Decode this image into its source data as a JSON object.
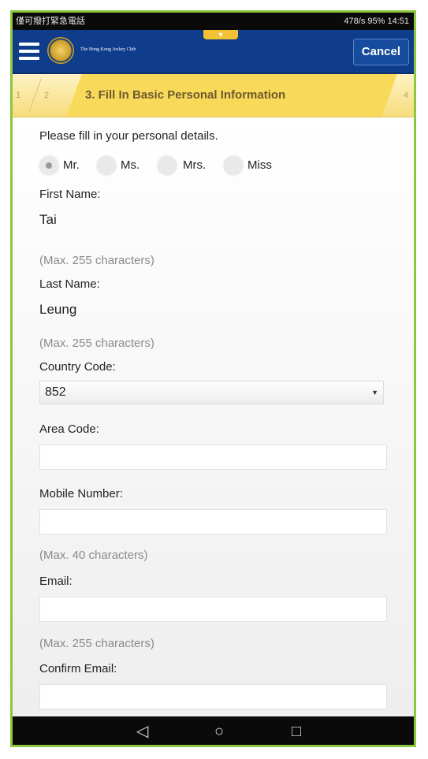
{
  "status_bar": {
    "left_text": "僅可撥打緊急電話",
    "right_text": "478/s  95%  14:51"
  },
  "header": {
    "logo_text": "The Hong Kong Jockey Club",
    "cancel_label": "Cancel"
  },
  "steps": {
    "step1": "1",
    "step2": "2",
    "current_label": "3. Fill In Basic Personal Information",
    "step4": "4"
  },
  "form": {
    "intro": "Please fill in your personal details.",
    "titles": [
      {
        "label": "Mr.",
        "checked": true
      },
      {
        "label": "Ms.",
        "checked": false
      },
      {
        "label": "Mrs.",
        "checked": false
      },
      {
        "label": "Miss",
        "checked": false
      }
    ],
    "first_name_label": "First Name:",
    "first_name_value": "Tai",
    "first_name_hint": "(Max. 255 characters)",
    "last_name_label": "Last Name:",
    "last_name_value": "Leung",
    "last_name_hint": "(Max. 255 characters)",
    "country_code_label": "Country Code:",
    "country_code_value": "852",
    "area_code_label": "Area Code:",
    "mobile_label": "Mobile Number:",
    "mobile_hint": "(Max. 40 characters)",
    "email_label": "Email:",
    "email_hint": "(Max. 255 characters)",
    "confirm_email_label": "Confirm Email:"
  },
  "nav": {
    "back": "◁",
    "home": "○",
    "recents": "□"
  }
}
